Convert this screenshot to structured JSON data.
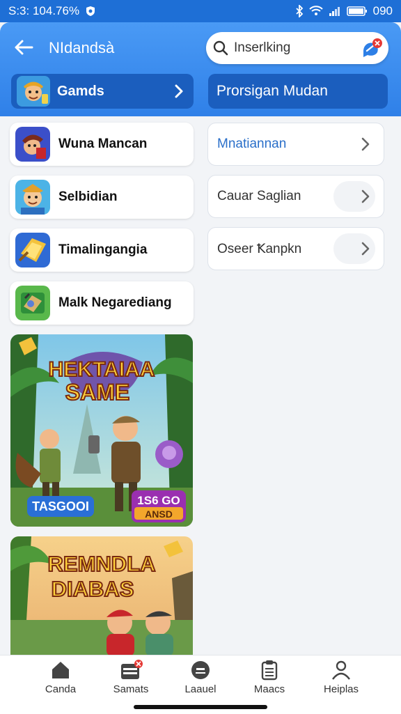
{
  "status": {
    "time": "S:3: 104.76%",
    "battery_pct": "090"
  },
  "header": {
    "title": "NIdandsà",
    "search_text": "Inserlking",
    "games_button": "Gamds",
    "program_button": "Prorsigan Mudan"
  },
  "left_list": [
    {
      "label": "Wuna Mancan"
    },
    {
      "label": "Selbidian"
    },
    {
      "label": "Timalingangia"
    },
    {
      "label": "Malk Negarediang"
    }
  ],
  "right_list": [
    {
      "label": "Mnatiannan"
    },
    {
      "label": "Cauar Saglian"
    },
    {
      "label": "Oseer Ꝁanpkn"
    }
  ],
  "banner1": {
    "title_line1": "HEKTAIAA",
    "title_line2": "SAME",
    "tag": "TASGOOI",
    "price_line1": "1S6 GO",
    "price_line2": "ANSD"
  },
  "banner2": {
    "title_line1": "REMNDLA",
    "title_line2": "DIABAS"
  },
  "bottom_nav": [
    {
      "label": "Canda"
    },
    {
      "label": "Samats"
    },
    {
      "label": "Laauel"
    },
    {
      "label": "Maacs"
    },
    {
      "label": "Heiplas"
    }
  ],
  "colors": {
    "primary": "#2f80e8",
    "dark_blue": "#1b5ebe",
    "accent_red": "#e53935"
  }
}
